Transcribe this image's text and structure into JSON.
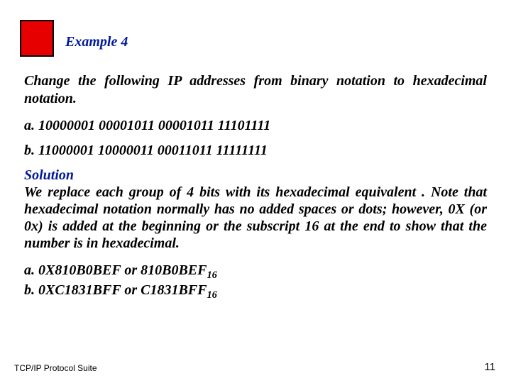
{
  "header": {
    "example_label": "Example 4"
  },
  "prompt": "Change the following IP addresses from binary notation to hexadecimal notation.",
  "items": {
    "a": "a. 10000001 00001011 00001011 11101111",
    "b": "b. 11000001 10000011 00011011 11111111"
  },
  "solution": {
    "heading": "Solution",
    "body": "We replace each group of 4 bits with its hexadecimal equivalent . Note that hexadecimal notation normally has no added spaces or dots; however, 0X (or 0x) is added at the beginning or the subscript 16 at the end to show that the number is in hexadecimal."
  },
  "answers": {
    "a_prefix": "a. 0X810B0BEF or 810B0BEF",
    "a_sub": "16",
    "b_prefix": "b. 0XC1831BFF or C1831BFF",
    "b_sub": "16"
  },
  "footer": {
    "left": "TCP/IP Protocol Suite",
    "right": "11"
  }
}
